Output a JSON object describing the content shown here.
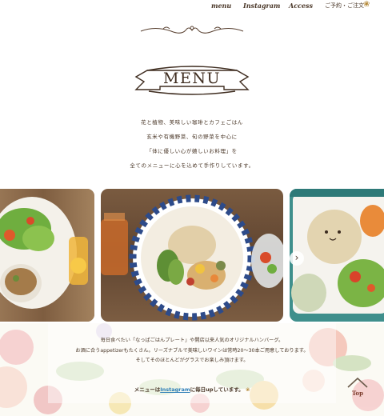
{
  "nav": {
    "items": [
      "menu",
      "Instagram",
      "Access"
    ],
    "reserve": "ご予約・ご注文"
  },
  "title": "MENU",
  "intro": [
    "花と植物、美味しい珈琲とカフェごはん",
    "玄米や有機野菜、旬の野菜を中心に",
    "「体に優しい心が嬉しいお料理」を",
    "全てのメニューに心を込めて手作りしています。"
  ],
  "carousel": {
    "slide_count": 6,
    "active_index": 5,
    "next_symbol": "›"
  },
  "description": [
    "毎日食べたい「なっぱごはんプレート」や開店以来人気のオリジナルハンバーグ。",
    "お酒に合うappetizerもたくさん。リーズナブルで美味しいワインは常時20～30本ご用意しております。",
    "そしてそのほとんどがグラスでお楽しみ頂けます。"
  ],
  "instagram_line": {
    "prefix": "メニューは",
    "link": "Instagram",
    "suffix": "に毎日upしています。"
  },
  "top_button": "Top",
  "colors": {
    "text": "#4a3728",
    "link": "#2f7fb8",
    "accent": "#b58a3a"
  }
}
